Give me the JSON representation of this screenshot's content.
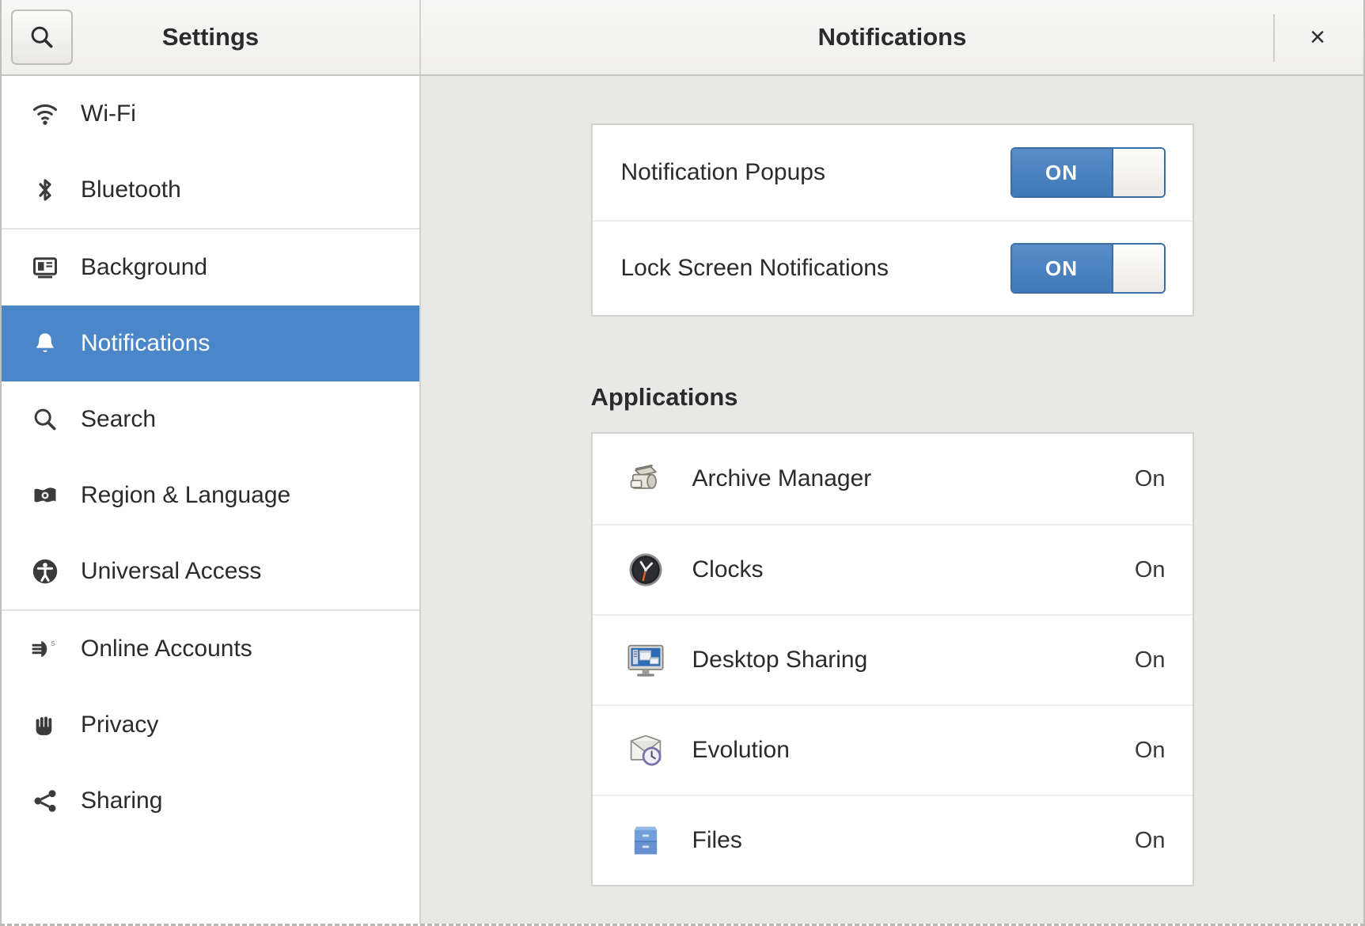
{
  "header": {
    "sidebar_title": "Settings",
    "panel_title": "Notifications",
    "search_icon": "search-icon",
    "close_label": "×"
  },
  "sidebar": {
    "items": [
      {
        "label": "Wi-Fi",
        "icon": "wifi-icon",
        "selected": false,
        "separator_after": false
      },
      {
        "label": "Bluetooth",
        "icon": "bluetooth-icon",
        "selected": false,
        "separator_after": true
      },
      {
        "label": "Background",
        "icon": "background-icon",
        "selected": false,
        "separator_after": false
      },
      {
        "label": "Notifications",
        "icon": "bell-icon",
        "selected": true,
        "separator_after": false
      },
      {
        "label": "Search",
        "icon": "search-icon",
        "selected": false,
        "separator_after": false
      },
      {
        "label": "Region & Language",
        "icon": "flag-icon",
        "selected": false,
        "separator_after": false
      },
      {
        "label": "Universal Access",
        "icon": "accessibility-icon",
        "selected": false,
        "separator_after": true
      },
      {
        "label": "Online Accounts",
        "icon": "online-accounts-icon",
        "selected": false,
        "separator_after": false
      },
      {
        "label": "Privacy",
        "icon": "hand-icon",
        "selected": false,
        "separator_after": false
      },
      {
        "label": "Sharing",
        "icon": "share-icon",
        "selected": false,
        "separator_after": false
      }
    ]
  },
  "main": {
    "switches": [
      {
        "label": "Notification Popups",
        "state": "ON"
      },
      {
        "label": "Lock Screen Notifications",
        "state": "ON"
      }
    ],
    "applications_heading": "Applications",
    "applications": [
      {
        "name": "Archive Manager",
        "state": "On",
        "icon": "archive-manager-icon"
      },
      {
        "name": "Clocks",
        "state": "On",
        "icon": "clocks-icon"
      },
      {
        "name": "Desktop Sharing",
        "state": "On",
        "icon": "desktop-sharing-icon"
      },
      {
        "name": "Evolution",
        "state": "On",
        "icon": "evolution-icon"
      },
      {
        "name": "Files",
        "state": "On",
        "icon": "files-icon"
      }
    ]
  },
  "colors": {
    "accent": "#4a86c8",
    "switch_on": "#3f79b8",
    "content_bg": "#e8e8e6"
  }
}
